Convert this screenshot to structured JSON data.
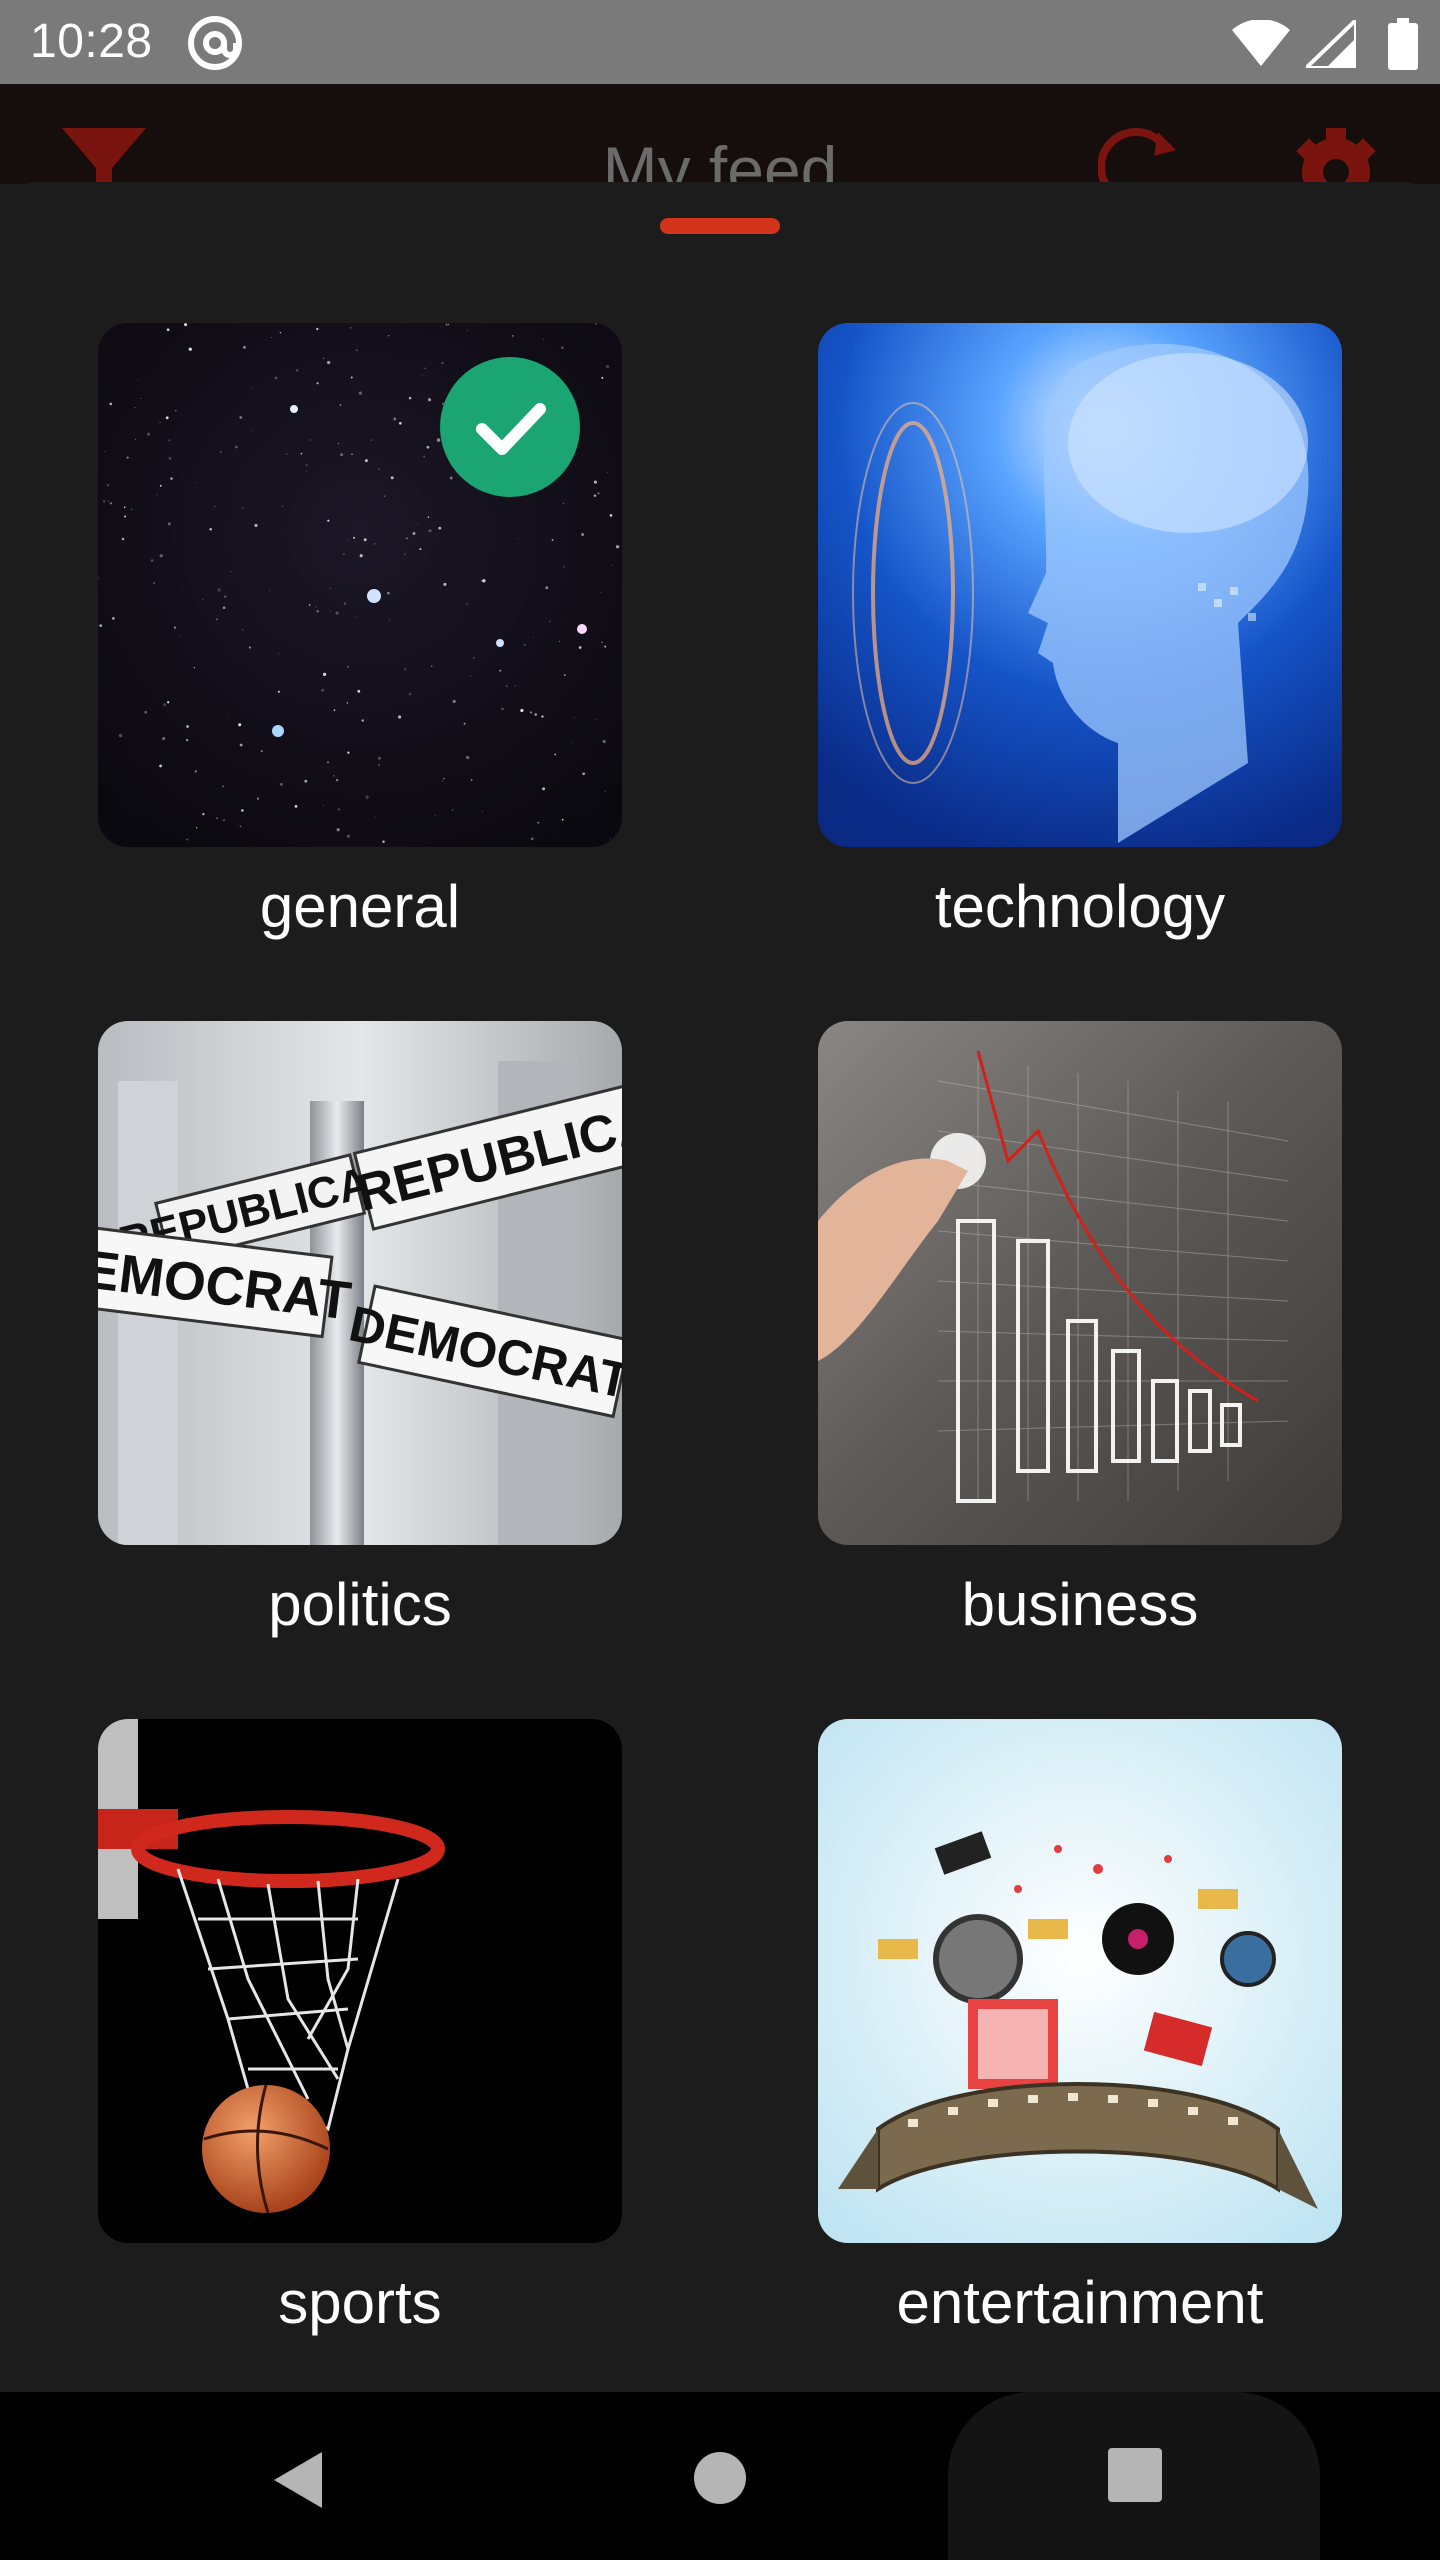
{
  "status_bar": {
    "time": "10:28",
    "icons": [
      "at-icon",
      "wifi-icon",
      "signal-icon",
      "battery-icon"
    ]
  },
  "header": {
    "title": "My feed",
    "icons": [
      "filter-icon",
      "refresh-icon",
      "settings-icon"
    ]
  },
  "colors": {
    "accent": "#d2341c",
    "sheet_background": "#1c1c1d",
    "selected_check": "#1aa572"
  },
  "categories": [
    {
      "label": "general",
      "selected": true,
      "image": "starry-night-sky"
    },
    {
      "label": "technology",
      "selected": false,
      "image": "digital-brain-head"
    },
    {
      "label": "politics",
      "selected": false,
      "image": "republican-democrat-street-signs"
    },
    {
      "label": "business",
      "selected": false,
      "image": "hand-drawn-bar-chart"
    },
    {
      "label": "sports",
      "selected": false,
      "image": "basketball-hoop"
    },
    {
      "label": "entertainment",
      "selected": false,
      "image": "film-and-music-burst"
    }
  ],
  "politics_signs": [
    "REPUBLICAN",
    "DEMOCRAT",
    "DEMOCRAT",
    "REPUBLICA"
  ],
  "navigation": {
    "buttons": [
      "back-icon",
      "home-icon",
      "recents-icon"
    ]
  }
}
